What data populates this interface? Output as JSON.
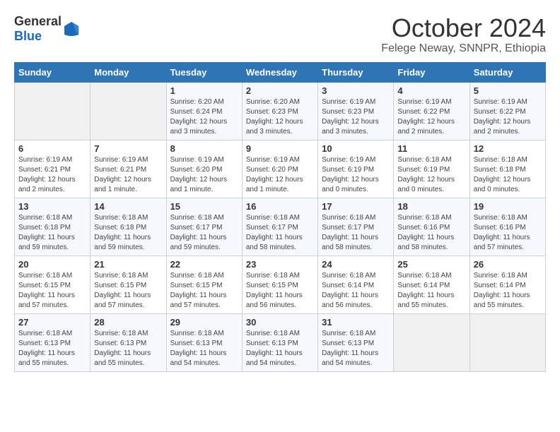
{
  "header": {
    "logo_general": "General",
    "logo_blue": "Blue",
    "month": "October 2024",
    "location": "Felege Neway, SNNPR, Ethiopia"
  },
  "days_of_week": [
    "Sunday",
    "Monday",
    "Tuesday",
    "Wednesday",
    "Thursday",
    "Friday",
    "Saturday"
  ],
  "weeks": [
    [
      {
        "day": "",
        "empty": true
      },
      {
        "day": "",
        "empty": true
      },
      {
        "day": "1",
        "sunrise": "Sunrise: 6:20 AM",
        "sunset": "Sunset: 6:24 PM",
        "daylight": "Daylight: 12 hours and 3 minutes."
      },
      {
        "day": "2",
        "sunrise": "Sunrise: 6:20 AM",
        "sunset": "Sunset: 6:23 PM",
        "daylight": "Daylight: 12 hours and 3 minutes."
      },
      {
        "day": "3",
        "sunrise": "Sunrise: 6:19 AM",
        "sunset": "Sunset: 6:23 PM",
        "daylight": "Daylight: 12 hours and 3 minutes."
      },
      {
        "day": "4",
        "sunrise": "Sunrise: 6:19 AM",
        "sunset": "Sunset: 6:22 PM",
        "daylight": "Daylight: 12 hours and 2 minutes."
      },
      {
        "day": "5",
        "sunrise": "Sunrise: 6:19 AM",
        "sunset": "Sunset: 6:22 PM",
        "daylight": "Daylight: 12 hours and 2 minutes."
      }
    ],
    [
      {
        "day": "6",
        "sunrise": "Sunrise: 6:19 AM",
        "sunset": "Sunset: 6:21 PM",
        "daylight": "Daylight: 12 hours and 2 minutes."
      },
      {
        "day": "7",
        "sunrise": "Sunrise: 6:19 AM",
        "sunset": "Sunset: 6:21 PM",
        "daylight": "Daylight: 12 hours and 1 minute."
      },
      {
        "day": "8",
        "sunrise": "Sunrise: 6:19 AM",
        "sunset": "Sunset: 6:20 PM",
        "daylight": "Daylight: 12 hours and 1 minute."
      },
      {
        "day": "9",
        "sunrise": "Sunrise: 6:19 AM",
        "sunset": "Sunset: 6:20 PM",
        "daylight": "Daylight: 12 hours and 1 minute."
      },
      {
        "day": "10",
        "sunrise": "Sunrise: 6:19 AM",
        "sunset": "Sunset: 6:19 PM",
        "daylight": "Daylight: 12 hours and 0 minutes."
      },
      {
        "day": "11",
        "sunrise": "Sunrise: 6:18 AM",
        "sunset": "Sunset: 6:19 PM",
        "daylight": "Daylight: 12 hours and 0 minutes."
      },
      {
        "day": "12",
        "sunrise": "Sunrise: 6:18 AM",
        "sunset": "Sunset: 6:18 PM",
        "daylight": "Daylight: 12 hours and 0 minutes."
      }
    ],
    [
      {
        "day": "13",
        "sunrise": "Sunrise: 6:18 AM",
        "sunset": "Sunset: 6:18 PM",
        "daylight": "Daylight: 11 hours and 59 minutes."
      },
      {
        "day": "14",
        "sunrise": "Sunrise: 6:18 AM",
        "sunset": "Sunset: 6:18 PM",
        "daylight": "Daylight: 11 hours and 59 minutes."
      },
      {
        "day": "15",
        "sunrise": "Sunrise: 6:18 AM",
        "sunset": "Sunset: 6:17 PM",
        "daylight": "Daylight: 11 hours and 59 minutes."
      },
      {
        "day": "16",
        "sunrise": "Sunrise: 6:18 AM",
        "sunset": "Sunset: 6:17 PM",
        "daylight": "Daylight: 11 hours and 58 minutes."
      },
      {
        "day": "17",
        "sunrise": "Sunrise: 6:18 AM",
        "sunset": "Sunset: 6:17 PM",
        "daylight": "Daylight: 11 hours and 58 minutes."
      },
      {
        "day": "18",
        "sunrise": "Sunrise: 6:18 AM",
        "sunset": "Sunset: 6:16 PM",
        "daylight": "Daylight: 11 hours and 58 minutes."
      },
      {
        "day": "19",
        "sunrise": "Sunrise: 6:18 AM",
        "sunset": "Sunset: 6:16 PM",
        "daylight": "Daylight: 11 hours and 57 minutes."
      }
    ],
    [
      {
        "day": "20",
        "sunrise": "Sunrise: 6:18 AM",
        "sunset": "Sunset: 6:15 PM",
        "daylight": "Daylight: 11 hours and 57 minutes."
      },
      {
        "day": "21",
        "sunrise": "Sunrise: 6:18 AM",
        "sunset": "Sunset: 6:15 PM",
        "daylight": "Daylight: 11 hours and 57 minutes."
      },
      {
        "day": "22",
        "sunrise": "Sunrise: 6:18 AM",
        "sunset": "Sunset: 6:15 PM",
        "daylight": "Daylight: 11 hours and 57 minutes."
      },
      {
        "day": "23",
        "sunrise": "Sunrise: 6:18 AM",
        "sunset": "Sunset: 6:15 PM",
        "daylight": "Daylight: 11 hours and 56 minutes."
      },
      {
        "day": "24",
        "sunrise": "Sunrise: 6:18 AM",
        "sunset": "Sunset: 6:14 PM",
        "daylight": "Daylight: 11 hours and 56 minutes."
      },
      {
        "day": "25",
        "sunrise": "Sunrise: 6:18 AM",
        "sunset": "Sunset: 6:14 PM",
        "daylight": "Daylight: 11 hours and 55 minutes."
      },
      {
        "day": "26",
        "sunrise": "Sunrise: 6:18 AM",
        "sunset": "Sunset: 6:14 PM",
        "daylight": "Daylight: 11 hours and 55 minutes."
      }
    ],
    [
      {
        "day": "27",
        "sunrise": "Sunrise: 6:18 AM",
        "sunset": "Sunset: 6:13 PM",
        "daylight": "Daylight: 11 hours and 55 minutes."
      },
      {
        "day": "28",
        "sunrise": "Sunrise: 6:18 AM",
        "sunset": "Sunset: 6:13 PM",
        "daylight": "Daylight: 11 hours and 55 minutes."
      },
      {
        "day": "29",
        "sunrise": "Sunrise: 6:18 AM",
        "sunset": "Sunset: 6:13 PM",
        "daylight": "Daylight: 11 hours and 54 minutes."
      },
      {
        "day": "30",
        "sunrise": "Sunrise: 6:18 AM",
        "sunset": "Sunset: 6:13 PM",
        "daylight": "Daylight: 11 hours and 54 minutes."
      },
      {
        "day": "31",
        "sunrise": "Sunrise: 6:18 AM",
        "sunset": "Sunset: 6:13 PM",
        "daylight": "Daylight: 11 hours and 54 minutes."
      },
      {
        "day": "",
        "empty": true
      },
      {
        "day": "",
        "empty": true
      }
    ]
  ]
}
